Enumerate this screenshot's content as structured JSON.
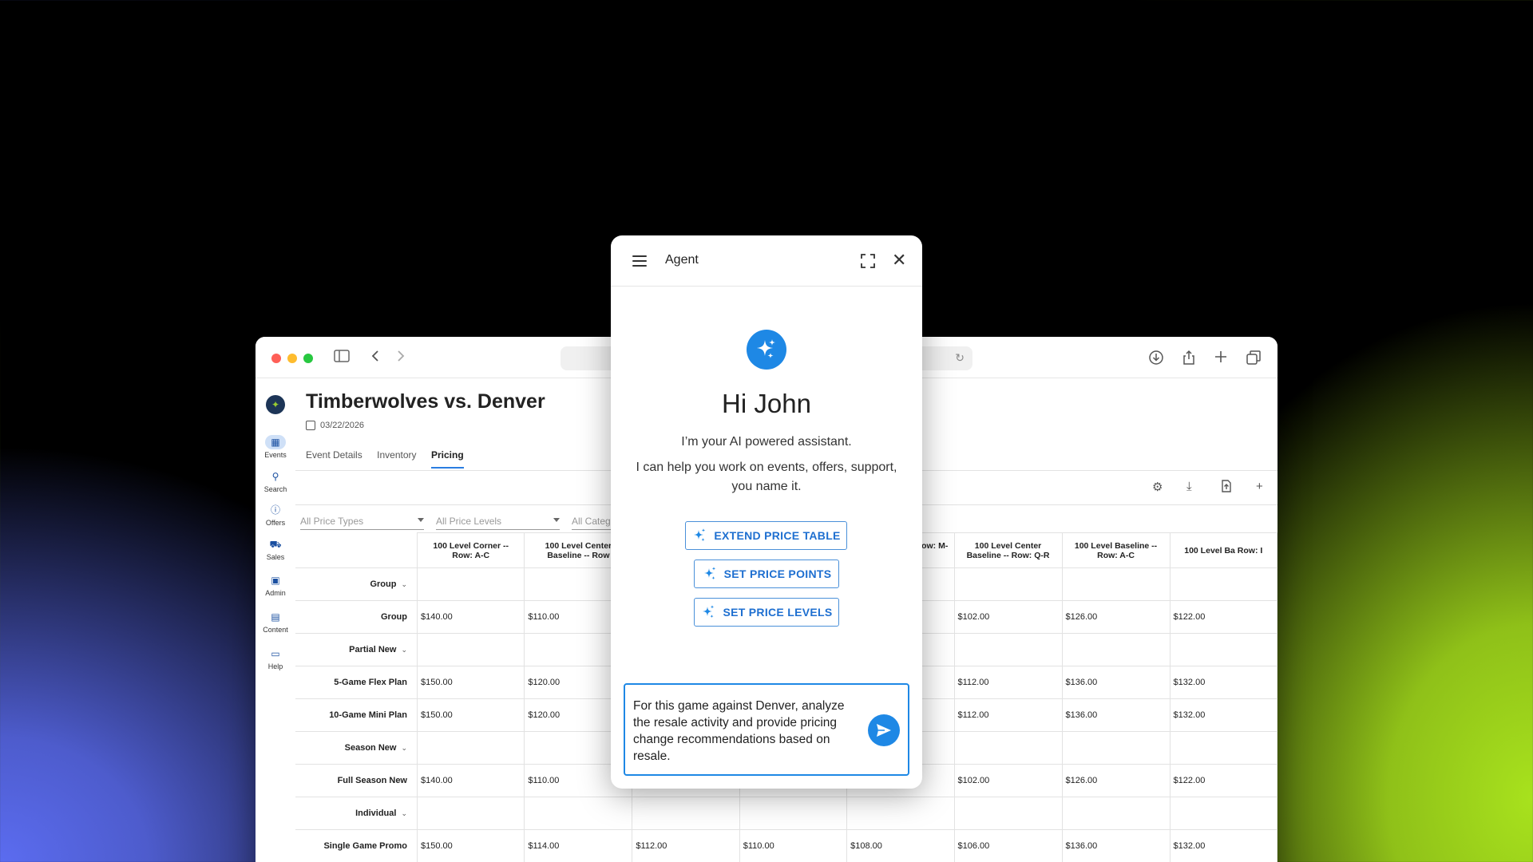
{
  "browser": {
    "icons": {
      "sidebar_toggle": "sidebar-icon",
      "back": "chevron-left-icon",
      "forward": "chevron-right-icon",
      "reload": "reload-icon",
      "download": "download-icon",
      "share": "share-icon",
      "new_tab": "plus-icon",
      "tabs": "tabs-icon"
    }
  },
  "sidebar": {
    "items": [
      {
        "label": "Events",
        "icon": "calendar-icon",
        "active": true
      },
      {
        "label": "Search",
        "icon": "search-icon"
      },
      {
        "label": "Offers",
        "icon": "offers-icon"
      },
      {
        "label": "Sales",
        "icon": "cart-icon"
      },
      {
        "label": "Admin",
        "icon": "admin-icon"
      },
      {
        "label": "Content",
        "icon": "content-icon"
      },
      {
        "label": "Help",
        "icon": "chat-icon"
      }
    ]
  },
  "event": {
    "title": "Timberwolves vs. Denver",
    "date": "03/22/2026",
    "tabs": [
      "Event Details",
      "Inventory",
      "Pricing"
    ],
    "active_tab": "Pricing"
  },
  "filters": {
    "price_types": "All Price Types",
    "price_levels": "All Price Levels",
    "categories": "All Categ"
  },
  "table": {
    "columns": [
      "100 Level Corner -- Row: A-C",
      "100 Level Center Baseline -- Row",
      "",
      "",
      "evel Center e -- Row: M-P",
      "100 Level Center Baseline -- Row: Q-R",
      "100 Level Baseline -- Row: A-C",
      "100 Level Ba Row: I"
    ],
    "rows": [
      {
        "label": "Group",
        "group": true,
        "cells": [
          "",
          "",
          "",
          "",
          "",
          "",
          "",
          ""
        ]
      },
      {
        "label": "Group",
        "group": false,
        "cells": [
          "$140.00",
          "$110.00",
          "",
          "",
          "",
          "$102.00",
          "$126.00",
          "$122.00"
        ]
      },
      {
        "label": "Partial New",
        "group": true,
        "cells": [
          "",
          "",
          "",
          "",
          "",
          "",
          "",
          ""
        ]
      },
      {
        "label": "5-Game Flex Plan",
        "group": false,
        "cells": [
          "$150.00",
          "$120.00",
          "",
          "",
          "",
          "$112.00",
          "$136.00",
          "$132.00"
        ]
      },
      {
        "label": "10-Game Mini Plan",
        "group": false,
        "cells": [
          "$150.00",
          "$120.00",
          "",
          "",
          "",
          "$112.00",
          "$136.00",
          "$132.00"
        ]
      },
      {
        "label": "Season New",
        "group": true,
        "cells": [
          "",
          "",
          "",
          "",
          "",
          "",
          "",
          ""
        ]
      },
      {
        "label": "Full Season New",
        "group": false,
        "cells": [
          "$140.00",
          "$110.00",
          "",
          "",
          "",
          "$102.00",
          "$126.00",
          "$122.00"
        ]
      },
      {
        "label": "Individual",
        "group": true,
        "cells": [
          "",
          "",
          "",
          "",
          "",
          "",
          "",
          ""
        ]
      },
      {
        "label": "Single Game Promo",
        "group": false,
        "cells": [
          "$150.00",
          "$114.00",
          "$112.00",
          "$110.00",
          "$108.00",
          "$106.00",
          "$136.00",
          "$132.00"
        ]
      }
    ]
  },
  "agent": {
    "title": "Agent",
    "greeting": "Hi John",
    "intro_line1": "I’m your AI powered assistant.",
    "intro_line2": "I can help you work on events, offers, support, you name it.",
    "actions": [
      "EXTEND PRICE TABLE",
      "SET PRICE POINTS",
      "SET PRICE LEVELS"
    ],
    "input_value": "For this game against Denver, analyze the resale activity and provide pricing change recommendations based on resale.",
    "accent_color": "#1e88e5"
  }
}
